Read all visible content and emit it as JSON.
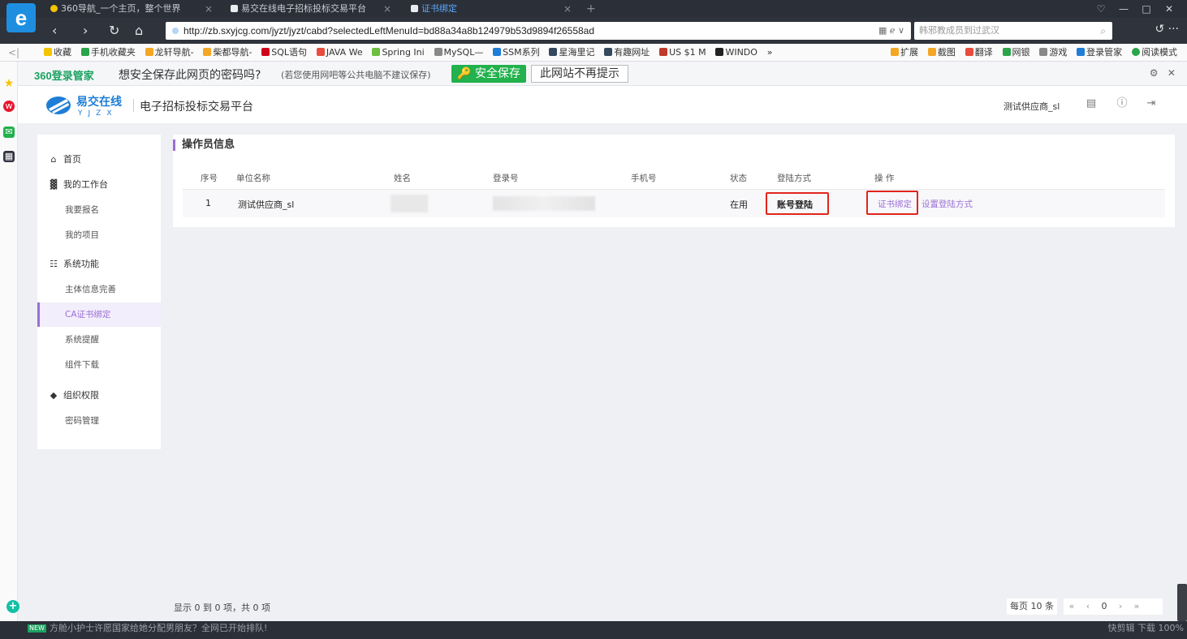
{
  "browser": {
    "logo": "e",
    "tabs": [
      {
        "title": "360导航_一个主页，整个世界",
        "active": false
      },
      {
        "title": "易交在线电子招标投标交易平台",
        "active": false
      },
      {
        "title": "证书绑定",
        "active": true
      }
    ],
    "tab_close": "×",
    "new_tab": "+",
    "window_controls": [
      "♡",
      "—",
      "□",
      "✕"
    ],
    "url": "http://zb.sxyjcg.com/jyzt/jyzt/cabd?selectedLeftMenuId=bd88a34a8b124979b53d9894f26558ad",
    "url_right": "▦ ℯ ∨",
    "search_placeholder": "韩邪教成员到过武汉",
    "favorites": [
      "收藏",
      "手机收藏夹",
      "龙轩导航-",
      "柴都导航-",
      "SQL语句",
      "JAVA We",
      "Spring Ini",
      "MySQL—",
      "SSM系列",
      "星海里记",
      "有趣网址",
      "US $1 M",
      "WINDO",
      "»"
    ],
    "fav_tools": [
      "扩展",
      "截图",
      "翻译",
      "网银",
      "游戏",
      "登录管家",
      "阅读模式"
    ]
  },
  "password_bar": {
    "brand": "360登录管家",
    "question": "想安全保存此网页的密码吗?",
    "hint": "(若您使用网吧等公共电脑不建议保存)",
    "save_label": "安全保存",
    "never_label": "此网站不再提示"
  },
  "header": {
    "logo_text": "易交在线",
    "logo_sub": "YJZX",
    "title": "电子招标投标交易平台",
    "user": "测试供应商_sl"
  },
  "menu": {
    "home": "首页",
    "workbench": "我的工作台",
    "signup": "我要报名",
    "projects": "我的项目",
    "system": "系统功能",
    "entity_info": "主体信息完善",
    "ca_bind": "CA证书绑定",
    "reminders": "系统提醒",
    "downloads": "组件下载",
    "org_perm": "组织权限",
    "password": "密码管理"
  },
  "content": {
    "title": "操作员信息",
    "columns": [
      "序号",
      "单位名称",
      "姓名",
      "登录号",
      "手机号",
      "状态",
      "登陆方式",
      "操 作"
    ],
    "rows": [
      {
        "index": "1",
        "unit": "测试供应商_sl",
        "name": "",
        "login": "",
        "phone": "",
        "status": "在用",
        "login_method": "账号登陆",
        "action_bind": "证书绑定",
        "action_set": "设置登陆方式"
      }
    ]
  },
  "pager": {
    "info": "显示 0 到 0 项，共 0 项",
    "page_size": "每页 10 条",
    "first": "«",
    "prev": "‹",
    "current": "0",
    "next": "›",
    "last": "»"
  },
  "statusbar": {
    "news_badge": "NEW",
    "news": "方舱小护士许愿国家给她分配男朋友？全网已开始排队!",
    "right": "快剪辑   下载   100%"
  },
  "colors": {
    "accent": "#9b6fd7",
    "highlight": "#e1251b",
    "save_green": "#22b14c"
  }
}
